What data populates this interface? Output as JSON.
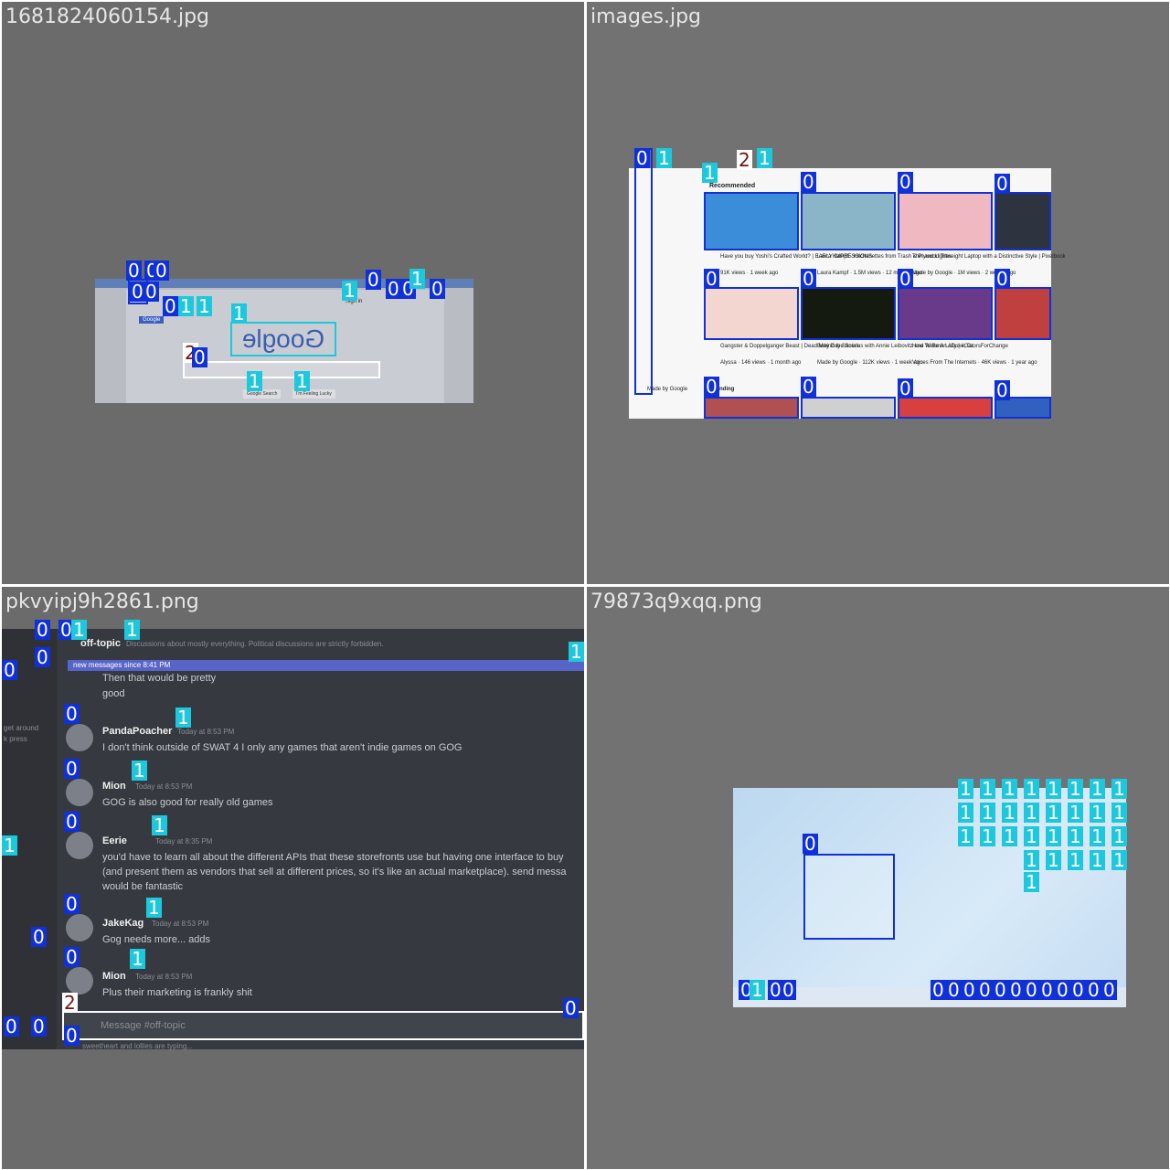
{
  "q1": {
    "filename": "1681824060154.jpg",
    "logo_text": "Google",
    "search_button": "Google Search",
    "lucky_button": "I'm Feeling Lucky",
    "tab_label": "Google",
    "header_link": "Sign in"
  },
  "q2": {
    "filename": "images.jpg",
    "section_title": "Recommended",
    "trending_label": "Trending",
    "videos": [
      {
        "title": "Have you buy Yoshi's Crafted World? | EARLY IMPRESSIONS",
        "meta": "91K views · 1 week ago"
      },
      {
        "title": "Laura Kampf - Kitchenettes from Trash & Plywood Tiles",
        "meta": "Laura Kampf · 1.5M views · 12 months ago"
      },
      {
        "title": "Thin and Lightweight Laptop with a Distinctive Style | Pixelbook",
        "meta": "Made by Google · 1M views · 2 weeks ago"
      },
      {
        "title": "Is Europe's Travel Uncovered Travel",
        "meta": "9K views · 2 weeks ago"
      },
      {
        "title": "Gangster & Doppelganger Beast | Dead May Day Santa's",
        "meta": "Alyssa · 146 views · 1 month ago"
      },
      {
        "title": "Behind the Scenes with Annie Leibovitz and Winona LaDuke, Dr.",
        "meta": "Made by Google · 112K views · 1 week ago"
      },
      {
        "title": "How To Be An Ally | #GatorsForChange",
        "meta": "Voices From The Internets · 46K views · 1 year ago"
      },
      {
        "title": "Accents, Words and Being a Fan - Joanna",
        "meta": "Joanna Rosenman · 140K views · 1 year ago"
      }
    ],
    "sidebar_footer": "Made by Google"
  },
  "q3": {
    "filename": "pkvyipj9h2861.png",
    "channel": "off-topic",
    "topic": "Discussions about mostly everything. Political discussions are strictly forbidden.",
    "new_messages": "new messages since 8:41 PM",
    "sidebar_snippet_a": "get around",
    "sidebar_snippet_b": "k press",
    "sidebar_snippet_c": "...",
    "messages": [
      {
        "author": "",
        "time": "",
        "text": "Then that would be pretty"
      },
      {
        "author": "",
        "time": "",
        "text": "good"
      },
      {
        "author": "PandaPoacher",
        "time": "Today at 8:53 PM",
        "text": "I don't think outside of SWAT 4 I only any games that aren't indie games on GOG"
      },
      {
        "author": "Mion",
        "time": "Today at 8:53 PM",
        "text": "GOG is also good for really old games"
      },
      {
        "author": "Eerie",
        "time": "Today at 8:35 PM",
        "text": "you'd have to learn all about the different APIs that these storefronts use but having one interface to buy",
        "text2": "(and present them as vendors that sell at different prices, so it's like an actual marketplace). send messa",
        "text3": "would be fantastic"
      },
      {
        "author": "JakeKag",
        "time": "Today at 8:53 PM",
        "text": "Gog needs more... adds"
      },
      {
        "author": "Mion",
        "time": "Today at 8:53 PM",
        "text": "Plus their marketing is frankly shit"
      }
    ],
    "input_placeholder": "Message #off-topic",
    "typing": "sweetheart and lollies are typing..."
  },
  "q4": {
    "filename": "79873q9xqq.png",
    "desktop_icon_count": 30,
    "taskbar_icon_count": 12
  },
  "colors": {
    "class0": "#1030d8",
    "class1": "#1ec8dc",
    "class2": "#ffffff",
    "discord_bg": "#36393f",
    "discord_side": "#2f3136"
  }
}
